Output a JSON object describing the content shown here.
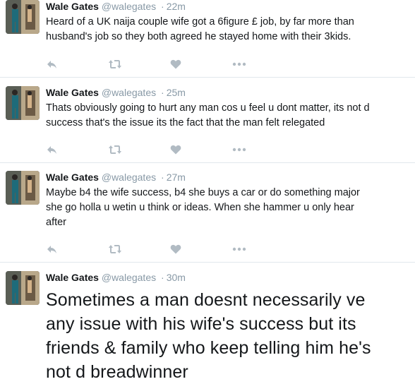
{
  "tweets": [
    {
      "name": "Wale Gates",
      "handle": "@walegates",
      "separator": "·",
      "time": "22m",
      "text": "Heard of a UK naija couple wife got a 6figure £ job, by far more than\nhusband's job so they both agreed he stayed home with their 3kids."
    },
    {
      "name": "Wale Gates",
      "handle": "@walegates",
      "separator": "·",
      "time": "25m",
      "text": "Thats obviously going to hurt any man cos u feel u dont matter, its not d\nsuccess that's the issue its the fact that the man felt relegated"
    },
    {
      "name": "Wale Gates",
      "handle": "@walegates",
      "separator": "·",
      "time": "27m",
      "text": "Maybe b4 the wife success, b4 she buys a car or do something major\nshe go holla u wetin u think or ideas. When she hammer u only hear\nafter"
    },
    {
      "name": "Wale Gates",
      "handle": "@walegates",
      "separator": "·",
      "time": "30m",
      "text": "Sometimes a man doesnt necessarily ve\nany issue with his wife's success but its\nfriends & family who keep telling him he's\nnot d breadwinner"
    }
  ],
  "icons": {
    "reply": "reply-icon",
    "retweet": "retweet-icon",
    "like": "heart-icon",
    "more": "more-icon"
  },
  "colors": {
    "icon_gray": "#b1bbc3",
    "meta_gray": "#8899a6",
    "divider": "#e1e8ed"
  }
}
